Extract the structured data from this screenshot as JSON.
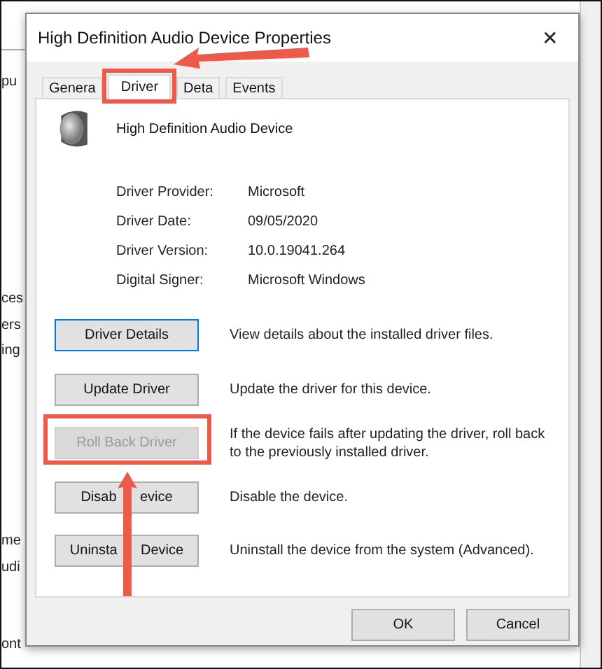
{
  "background_window": {
    "fragments": [
      "pu",
      "ces",
      "ers",
      "ing",
      "me",
      "udi",
      "ont"
    ]
  },
  "window": {
    "title": "High Definition Audio Device Properties",
    "close": "✕"
  },
  "tabs": [
    {
      "label": "Genera",
      "selected": false,
      "highlighted": false
    },
    {
      "label": "Driver",
      "selected": true,
      "highlighted": true
    },
    {
      "label": "Deta",
      "selected": false,
      "highlighted": false
    },
    {
      "label": "Events",
      "selected": false,
      "highlighted": false
    }
  ],
  "device": {
    "name": "High Definition Audio Device"
  },
  "details": [
    {
      "label": "Driver Provider:",
      "value": "Microsoft"
    },
    {
      "label": "Driver Date:",
      "value": "09/05/2020"
    },
    {
      "label": "Driver Version:",
      "value": "10.0.19041.264"
    },
    {
      "label": "Digital Signer:",
      "value": "Microsoft Windows"
    }
  ],
  "actions": [
    {
      "label": "Driver Details",
      "disabled": false,
      "highlighted": false,
      "description": "View details about the installed driver files."
    },
    {
      "label": "Update Driver",
      "disabled": false,
      "highlighted": false,
      "description": "Update the driver for this device."
    },
    {
      "label": "Roll Back Driver",
      "disabled": true,
      "highlighted": true,
      "description": "If the device fails after updating the driver, roll back to the previously installed driver."
    },
    {
      "label": "Disab      evice",
      "disabled": false,
      "highlighted": false,
      "description": "Disable the device."
    },
    {
      "label": "Uninsta      Device",
      "disabled": false,
      "highlighted": false,
      "description": "Uninstall the device from the system (Advanced)."
    }
  ],
  "buttons": [
    "OK",
    "Cancel"
  ]
}
